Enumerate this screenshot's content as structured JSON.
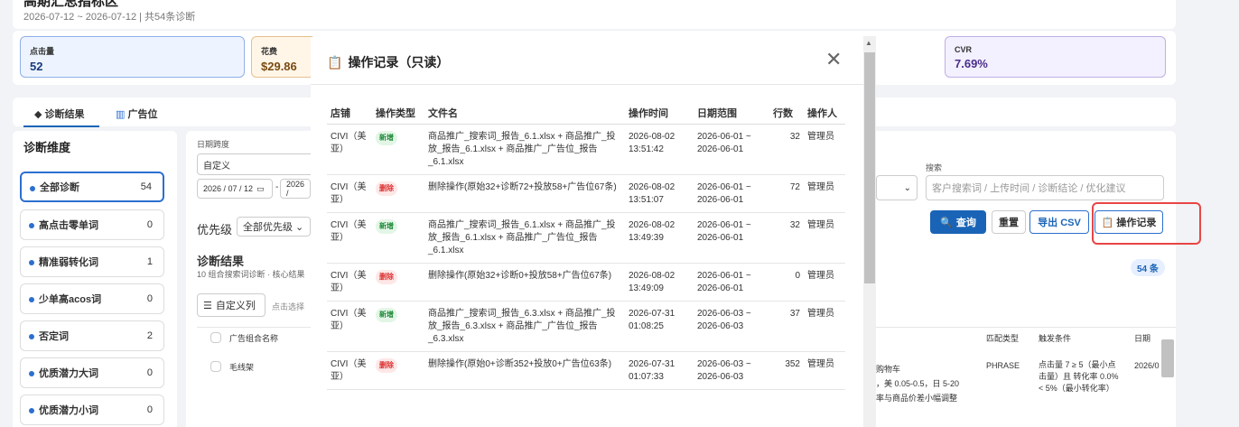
{
  "header": {
    "title": "高期汇总指标区",
    "subtitle": "2026-07-12 ~ 2026-07-12 | 共54条诊断"
  },
  "kpis": [
    {
      "label": "点击量",
      "value": "52",
      "color": "#1a3a7a",
      "bg": "#eef4ff",
      "border": "#8fb0e6"
    },
    {
      "label": "花费",
      "value": "$29.86",
      "color": "#7a4a10",
      "bg": "#fff6e8",
      "border": "#e6c08f"
    },
    {
      "label": "CVR",
      "value": "7.69%",
      "color": "#4a2e8a",
      "bg": "#f3f0ff",
      "border": "#bfb0e6"
    }
  ],
  "tabs": [
    {
      "label": "诊断结果",
      "icon": "diamond-icon"
    },
    {
      "label": "广告位",
      "icon": "chart-icon"
    }
  ],
  "sidebar": {
    "title": "诊断维度",
    "items": [
      {
        "label": "全部诊断",
        "count": "54"
      },
      {
        "label": "高点击零单词",
        "count": "0"
      },
      {
        "label": "精准弱转化词",
        "count": "1"
      },
      {
        "label": "少单高acos词",
        "count": "0"
      },
      {
        "label": "否定词",
        "count": "2"
      },
      {
        "label": "优质潜力大词",
        "count": "0"
      },
      {
        "label": "优质潜力小词",
        "count": "0"
      }
    ]
  },
  "filters": {
    "date_label": "日期跨度",
    "date_mode": "自定义",
    "date_start": "2026 / 07 / 12",
    "date_end": "2026 /",
    "search_label": "搜索",
    "search_placeholder": "客户搜索词 / 上传时间 / 诊断结论 / 优化建议",
    "priority_label": "优先级",
    "priority_value": "全部优先级"
  },
  "buttons": {
    "query": "查询",
    "reset": "重置",
    "export": "导出 CSV",
    "log": "操作记录"
  },
  "results": {
    "title": "诊断结果",
    "subtitle": "10 组合搜索词诊断 · 核心结果",
    "count_badge": "54 条",
    "custom_cols": "自定义列",
    "hint": "点击选择",
    "col_group": "广告组合名称",
    "row1_name": "毛线架",
    "col_match": "匹配类型",
    "col_trigger": "触发条件",
    "col_date": "日期",
    "row1_match": "PHRASE",
    "row1_trigger": "点击量 7 ≥ 5（最小点击量）且 转化率 0.0% < 5%（最小转化率）",
    "row1_date": "2026/0",
    "row1_suggest_a": "购物车",
    "row1_suggest_b": "，美 0.05-0.5，日 5-20",
    "row1_suggest_c": "率与商品价差小幅调整"
  },
  "modal": {
    "title": "操作记录（只读）",
    "headers": [
      "店铺",
      "操作类型",
      "文件名",
      "操作时间",
      "日期范围",
      "行数",
      "操作人"
    ],
    "rows": [
      {
        "store": "CIVI（美亚）",
        "type": "新增",
        "file": "商品推广_搜索词_报告_6.1.xlsx + 商品推广_投放_报告_6.1.xlsx + 商品推广_广告位_报告_6.1.xlsx",
        "time": "2026-08-02 13:51:42",
        "range": "2026-06-01 ~ 2026-06-01",
        "rows": "32",
        "user": "管理员"
      },
      {
        "store": "CIVI（美亚）",
        "type": "删除",
        "file": "删除操作(原始32+诊断72+投放58+广告位67条)",
        "time": "2026-08-02 13:51:07",
        "range": "2026-06-01 ~ 2026-06-01",
        "rows": "72",
        "user": "管理员"
      },
      {
        "store": "CIVI（美亚）",
        "type": "新增",
        "file": "商品推广_搜索词_报告_6.1.xlsx + 商品推广_投放_报告_6.1.xlsx + 商品推广_广告位_报告_6.1.xlsx",
        "time": "2026-08-02 13:49:39",
        "range": "2026-06-01 ~ 2026-06-01",
        "rows": "32",
        "user": "管理员"
      },
      {
        "store": "CIVI（美亚）",
        "type": "删除",
        "file": "删除操作(原始32+诊断0+投放58+广告位67条)",
        "time": "2026-08-02 13:49:09",
        "range": "2026-06-01 ~ 2026-06-01",
        "rows": "0",
        "user": "管理员"
      },
      {
        "store": "CIVI（美亚）",
        "type": "新增",
        "file": "商品推广_搜索词_报告_6.3.xlsx + 商品推广_投放_报告_6.3.xlsx + 商品推广_广告位_报告_6.3.xlsx",
        "time": "2026-07-31 01:08:25",
        "range": "2026-06-03 ~ 2026-06-03",
        "rows": "37",
        "user": "管理员"
      },
      {
        "store": "CIVI（美亚）",
        "type": "删除",
        "file": "删除操作(原始0+诊断352+投放0+广告位63条)",
        "time": "2026-07-31 01:07:33",
        "range": "2026-06-03 ~ 2026-06-03",
        "rows": "352",
        "user": "管理员"
      }
    ]
  }
}
